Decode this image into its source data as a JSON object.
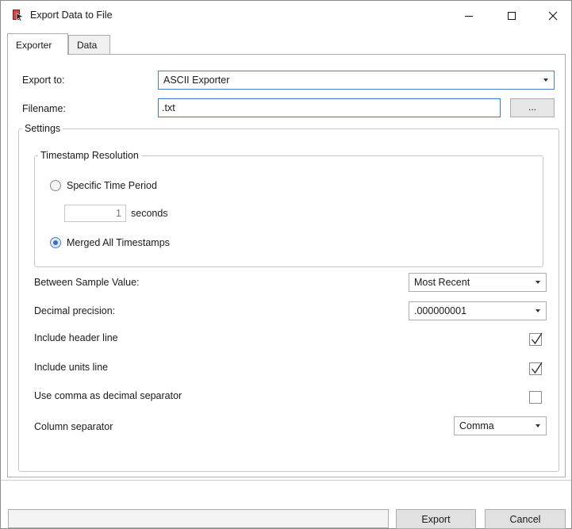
{
  "window": {
    "title": "Export Data to File",
    "icon": "export-data-app-icon"
  },
  "tabs": [
    {
      "label": "Exporter",
      "active": true
    },
    {
      "label": "Data",
      "active": false
    }
  ],
  "export": {
    "export_to_label": "Export to:",
    "export_to_value": "ASCII Exporter",
    "filename_label": "Filename:",
    "filename_value": ".txt",
    "browse_label": "..."
  },
  "settings": {
    "legend": "Settings",
    "timestamp": {
      "legend": "Timestamp Resolution",
      "specific_label": "Specific Time Period",
      "specific_selected": false,
      "seconds_value": "1",
      "seconds_label": "seconds",
      "merged_label": "Merged All Timestamps",
      "merged_selected": true
    },
    "between_sample_label": "Between Sample Value:",
    "between_sample_value": "Most Recent",
    "decimal_precision_label": "Decimal precision:",
    "decimal_precision_value": ".000000001",
    "include_header_label": "Include header line",
    "include_header_checked": true,
    "include_units_label": "Include units line",
    "include_units_checked": true,
    "comma_decimal_label": "Use comma as decimal separator",
    "comma_decimal_checked": false,
    "column_separator_label": "Column separator",
    "column_separator_value": "Comma"
  },
  "footer": {
    "export_label": "Export",
    "cancel_label": "Cancel"
  }
}
